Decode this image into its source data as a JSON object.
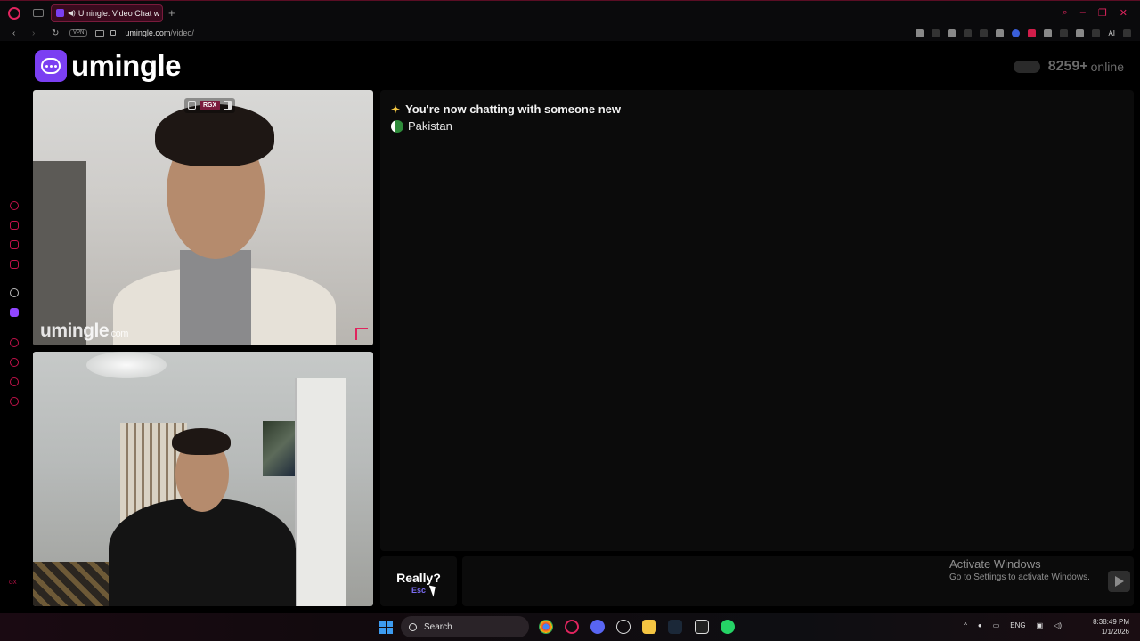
{
  "browser": {
    "tab_title": "Umingle: Video Chat w",
    "new_tab": "+",
    "vpn_label": "VPN",
    "url_host": "umingle.com",
    "url_path": "/video/",
    "ai_label": "AI"
  },
  "sidebar": {
    "gx_label": "GX"
  },
  "header": {
    "logo_text": "umingle",
    "online_count": "8259+",
    "online_label": "online"
  },
  "stranger_video": {
    "watermark": "umingle",
    "watermark_suffix": ".com",
    "pip_badge": "RGX"
  },
  "chat": {
    "system_message": "You're now chatting with someone new",
    "country": "Pakistan"
  },
  "controls": {
    "skip_label": "Really?",
    "skip_key": "Esc"
  },
  "windows_notice": {
    "line1": "Activate Windows",
    "line2": "Go to Settings to activate Windows."
  },
  "taskbar": {
    "search_label": "Search",
    "lang": "ENG",
    "time": "8:38:49 PM",
    "date": "1/1/2026"
  },
  "colors": {
    "accent": "#e0245e",
    "brand": "#7b3ff2"
  }
}
